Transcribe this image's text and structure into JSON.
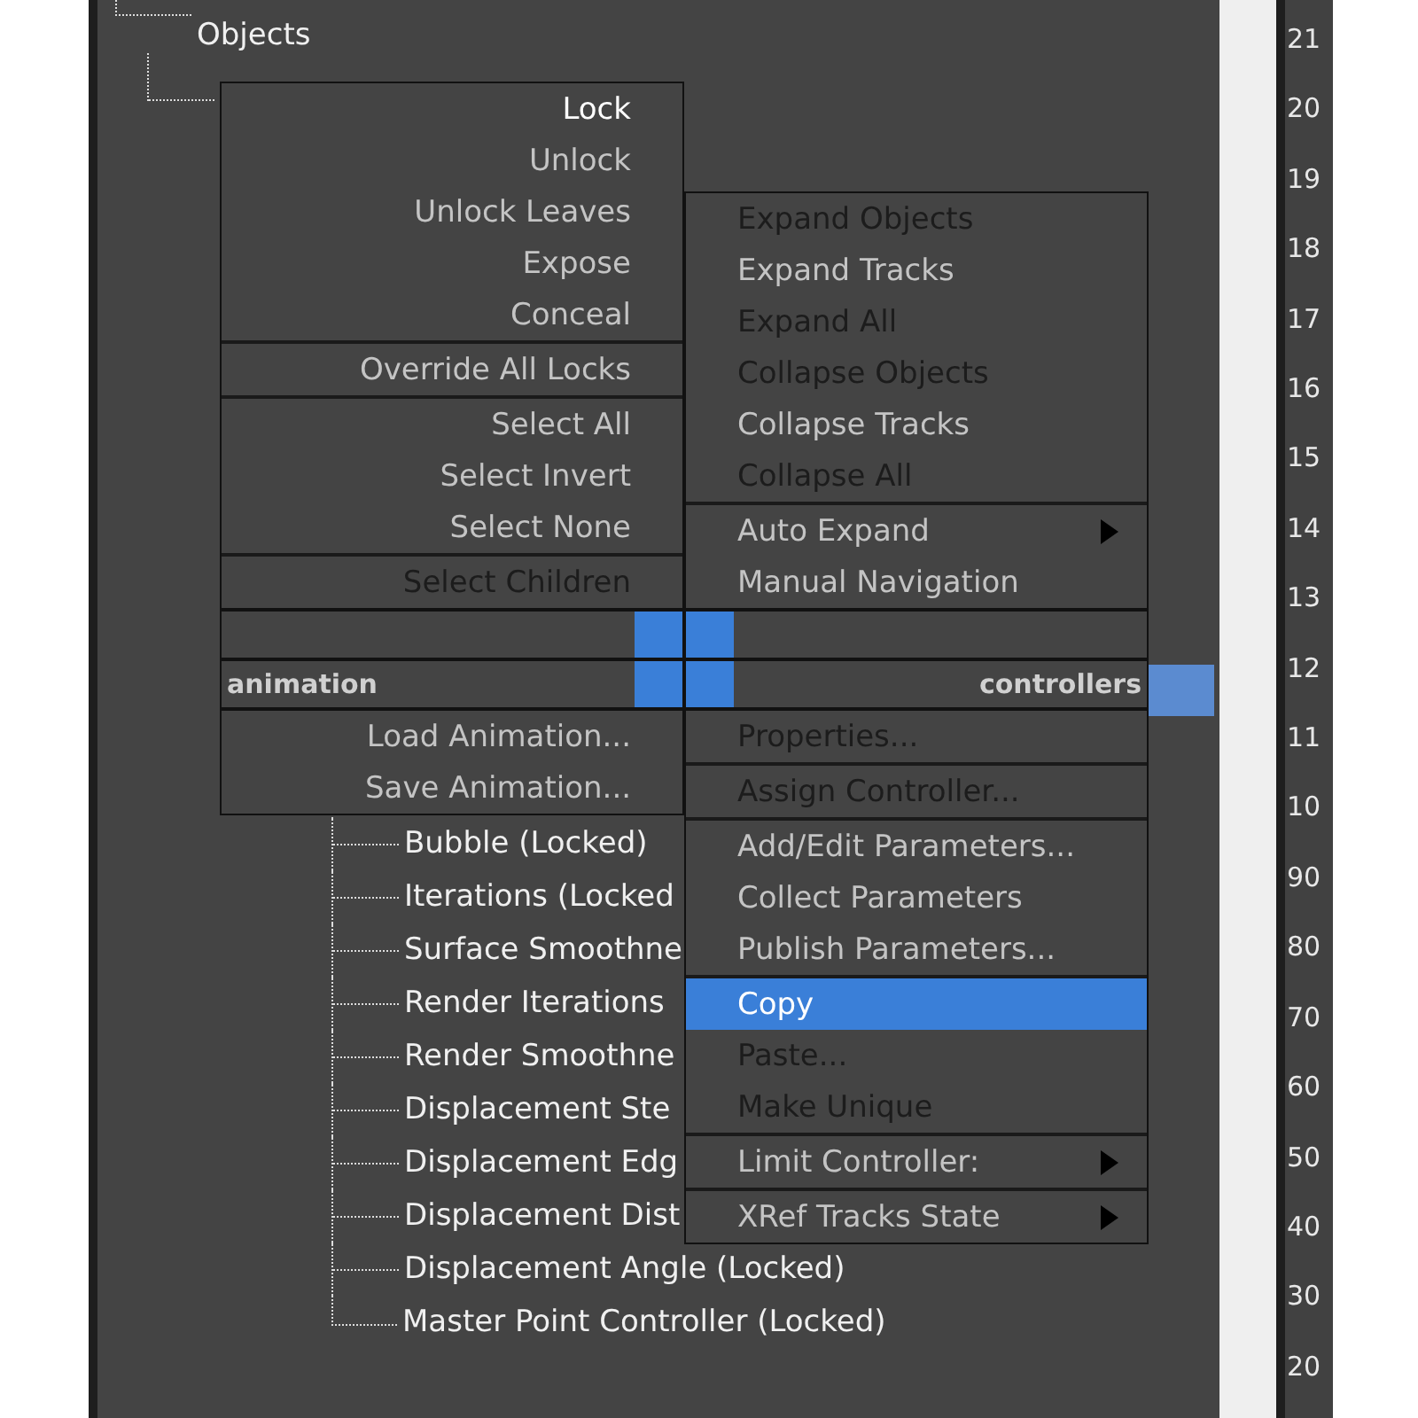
{
  "tree": {
    "items": [
      {
        "label": "Objects",
        "children": [
          {
            "children": [
              {
                "label": "Bubble (Locked)"
              },
              {
                "label": "Iterations (Locked"
              },
              {
                "label": "Surface Smoothne"
              },
              {
                "label": "Render Iterations"
              },
              {
                "label": "Render Smoothne"
              },
              {
                "label": "Displacement Ste"
              },
              {
                "label": "Displacement Edg"
              },
              {
                "label": "Displacement Dist"
              },
              {
                "label": "Displacement Angle (Locked)"
              },
              {
                "label": "Master Point Controller (Locked)"
              }
            ]
          }
        ]
      }
    ]
  },
  "quad_menu": {
    "top_left": {
      "groups": [
        [
          {
            "label": "Lock",
            "default": true,
            "disabled": false,
            "selected": false,
            "submenu": false
          },
          {
            "label": "Unlock",
            "default": false,
            "disabled": false,
            "selected": false,
            "submenu": false
          },
          {
            "label": "Unlock Leaves",
            "default": false,
            "disabled": false,
            "selected": false,
            "submenu": false
          },
          {
            "label": "Expose",
            "default": false,
            "disabled": false,
            "selected": false,
            "submenu": false
          },
          {
            "label": "Conceal",
            "default": false,
            "disabled": false,
            "selected": false,
            "submenu": false
          }
        ],
        [
          {
            "label": "Override All Locks",
            "default": false,
            "disabled": false,
            "selected": false,
            "submenu": false
          }
        ],
        [
          {
            "label": "Select All",
            "default": false,
            "disabled": false,
            "selected": false,
            "submenu": false
          },
          {
            "label": "Select Invert",
            "default": false,
            "disabled": false,
            "selected": false,
            "submenu": false
          },
          {
            "label": "Select None",
            "default": false,
            "disabled": false,
            "selected": false,
            "submenu": false
          }
        ],
        [
          {
            "label": "Select Children",
            "default": false,
            "disabled": true,
            "selected": false,
            "submenu": false
          }
        ]
      ]
    },
    "top_right": {
      "groups": [
        [
          {
            "label": "Expand Objects",
            "disabled": true,
            "selected": false,
            "submenu": false
          },
          {
            "label": "Expand Tracks",
            "disabled": false,
            "selected": false,
            "submenu": false
          },
          {
            "label": "Expand All",
            "disabled": true,
            "selected": false,
            "submenu": false
          },
          {
            "label": "Collapse Objects",
            "disabled": true,
            "selected": false,
            "submenu": false
          },
          {
            "label": "Collapse Tracks",
            "disabled": false,
            "selected": false,
            "submenu": false
          },
          {
            "label": "Collapse All",
            "disabled": true,
            "selected": false,
            "submenu": false
          }
        ],
        [
          {
            "label": "Auto Expand",
            "disabled": false,
            "selected": false,
            "submenu": true
          },
          {
            "label": "Manual Navigation",
            "disabled": false,
            "selected": false,
            "submenu": false
          }
        ]
      ]
    },
    "bottom_left": {
      "title": "animation",
      "active": false,
      "groups": [
        [
          {
            "label": "Load Animation...",
            "disabled": false,
            "selected": false,
            "submenu": false
          },
          {
            "label": "Save Animation...",
            "disabled": false,
            "selected": false,
            "submenu": false
          }
        ]
      ]
    },
    "bottom_right": {
      "title": "controllers",
      "active": true,
      "groups": [
        [
          {
            "label": "Properties...",
            "disabled": true,
            "selected": false,
            "submenu": false
          }
        ],
        [
          {
            "label": "Assign Controller...",
            "disabled": true,
            "selected": false,
            "submenu": false
          }
        ],
        [
          {
            "label": "Add/Edit Parameters...",
            "disabled": false,
            "selected": false,
            "submenu": false
          },
          {
            "label": "Collect Parameters",
            "disabled": false,
            "selected": false,
            "submenu": false
          },
          {
            "label": "Publish Parameters...",
            "disabled": false,
            "selected": false,
            "submenu": false
          }
        ],
        [
          {
            "label": "Copy",
            "disabled": false,
            "selected": true,
            "submenu": false
          },
          {
            "label": "Paste...",
            "disabled": true,
            "selected": false,
            "submenu": false
          },
          {
            "label": "Make Unique",
            "disabled": true,
            "selected": false,
            "submenu": false
          }
        ],
        [
          {
            "label": "Limit Controller:",
            "disabled": false,
            "selected": false,
            "submenu": true
          }
        ],
        [
          {
            "label": "XRef Tracks State",
            "disabled": false,
            "selected": false,
            "submenu": true
          }
        ]
      ]
    }
  },
  "ruler": {
    "labels": [
      "21",
      "20",
      "19",
      "18",
      "17",
      "16",
      "15",
      "14",
      "13",
      "12",
      "11",
      "10",
      "90",
      "80",
      "70",
      "60",
      "50",
      "40",
      "30",
      "20"
    ]
  }
}
